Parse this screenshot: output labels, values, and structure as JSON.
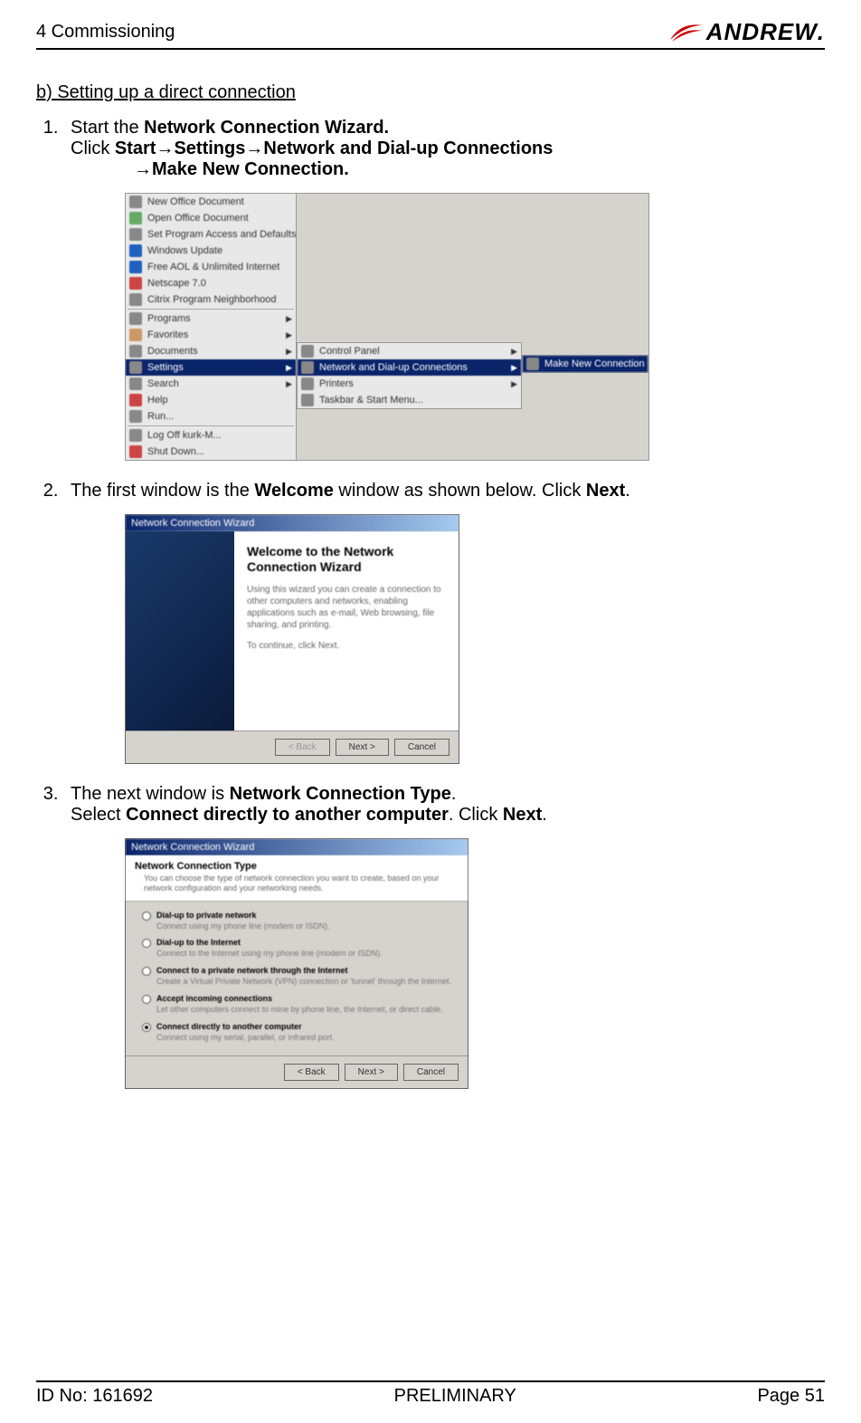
{
  "header": {
    "chapter": "4 Commissioning",
    "brand": "ANDREW"
  },
  "section": {
    "title": "b) Setting up a direct connection"
  },
  "steps": {
    "s1": {
      "line1_a": "Start the ",
      "line1_b": "Network Connection Wizard.",
      "line2_a": "Click ",
      "line2_b": "Start",
      "line2_c": "Settings",
      "line2_d": "Network and Dial-up Connections",
      "line3_a": "Make New Connection."
    },
    "s2": {
      "a": "The first window is the ",
      "b": "Welcome",
      "c": " window as shown below. Click ",
      "d": "Next",
      "e": "."
    },
    "s3": {
      "a": "The next window is ",
      "b": "Network Connection Type",
      "c": ".",
      "d": "Select ",
      "e": "Connect directly to another computer",
      "f": ". Click ",
      "g": "Next",
      "h": "."
    }
  },
  "ss1": {
    "items": [
      "New Office Document",
      "Open Office Document",
      "Set Program Access and Defaults",
      "Windows Update",
      "Free AOL & Unlimited Internet",
      "Netscape 7.0",
      "Citrix Program Neighborhood"
    ],
    "items2": [
      "Programs",
      "Favorites",
      "Documents"
    ],
    "settings": "Settings",
    "items3": [
      "Search",
      "Help",
      "Run..."
    ],
    "items4": [
      "Log Off kurk-M...",
      "Shut Down..."
    ],
    "sub1": [
      "Control Panel",
      "Network and Dial-up Connections",
      "Printers",
      "Taskbar & Start Menu..."
    ],
    "sub2": "Make New Connection"
  },
  "ss2": {
    "title": "Network Connection Wizard",
    "heading": "Welcome to the Network Connection Wizard",
    "para1": "Using this wizard you can create a connection to other computers and networks, enabling applications such as e-mail, Web browsing, file sharing, and printing.",
    "para2": "To continue, click Next.",
    "back": "< Back",
    "next": "Next >",
    "cancel": "Cancel"
  },
  "ss3": {
    "titlebar": "Network Connection Wizard",
    "head_title": "Network Connection Type",
    "head_sub": "You can choose the type of network connection you want to create, based on your network configuration and your networking needs.",
    "opts": [
      {
        "label": "Dial-up to private network",
        "desc": "Connect using my phone line (modem or ISDN)."
      },
      {
        "label": "Dial-up to the Internet",
        "desc": "Connect to the Internet using my phone line (modem or ISDN)."
      },
      {
        "label": "Connect to a private network through the Internet",
        "desc": "Create a Virtual Private Network (VPN) connection or 'tunnel' through the Internet."
      },
      {
        "label": "Accept incoming connections",
        "desc": "Let other computers connect to mine by phone line, the Internet, or direct cable."
      },
      {
        "label": "Connect directly to another computer",
        "desc": "Connect using my serial, parallel, or infrared port."
      }
    ],
    "back": "< Back",
    "next": "Next >",
    "cancel": "Cancel"
  },
  "footer": {
    "id": "ID No: 161692",
    "status": "PRELIMINARY",
    "page": "Page 51"
  }
}
